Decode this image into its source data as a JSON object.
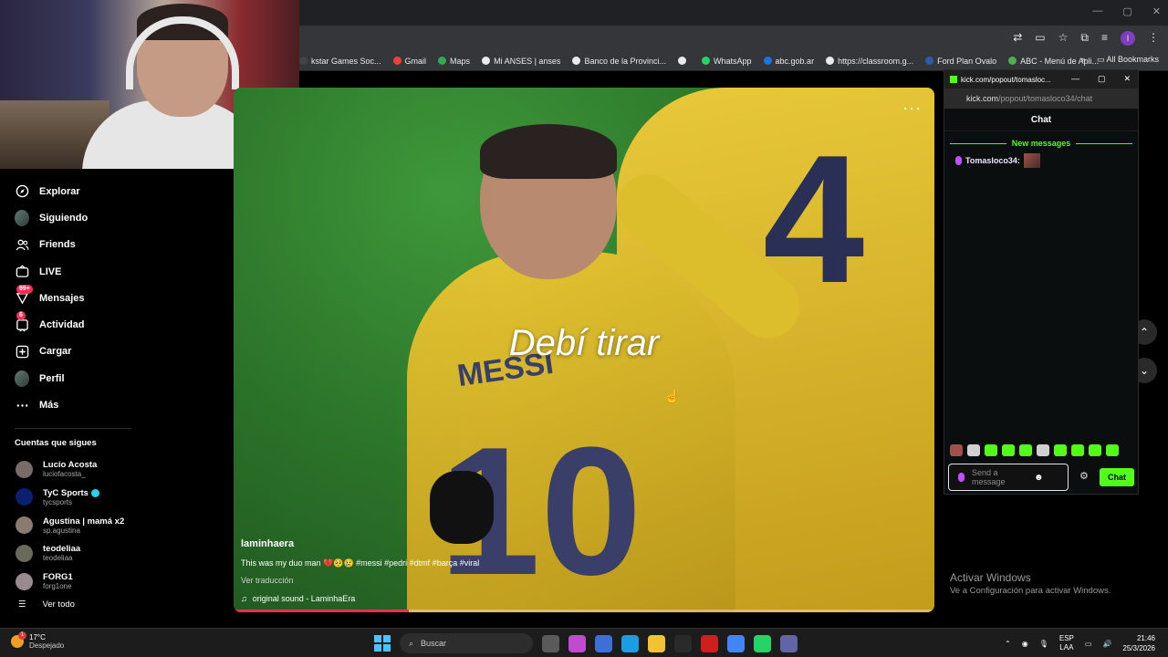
{
  "browser": {
    "bookmarks": [
      {
        "label": "kstar Games Soc...",
        "color": "#444"
      },
      {
        "label": "Gmail",
        "color": "#ea4335"
      },
      {
        "label": "Maps",
        "color": "#34a853"
      },
      {
        "label": "Mi ANSES | anses",
        "color": "#e8eaed"
      },
      {
        "label": "Banco de la Provinci...",
        "color": "#e8eaed"
      },
      {
        "label": "",
        "color": "#e8eaed"
      },
      {
        "label": "WhatsApp",
        "color": "#25d366"
      },
      {
        "label": "abc.gob.ar",
        "color": "#1a73e8"
      },
      {
        "label": "https://classroom.g...",
        "color": "#e8eaed"
      },
      {
        "label": "Ford Plan Ovalo",
        "color": "#2b5ca8"
      },
      {
        "label": "ABC - Menú de Apli...",
        "color": "#4caf50"
      }
    ],
    "all_bookmarks": "All Bookmarks",
    "profile_initial": "I"
  },
  "sidebar": {
    "nav": [
      {
        "label": "Explorar",
        "icon": "compass-icon",
        "badge": ""
      },
      {
        "label": "Siguiendo",
        "icon": "avatar",
        "badge": ""
      },
      {
        "label": "Friends",
        "icon": "friends-icon",
        "badge": ""
      },
      {
        "label": "LIVE",
        "icon": "live-icon",
        "badge": ""
      },
      {
        "label": "Mensajes",
        "icon": "messages-icon",
        "badge": "99+"
      },
      {
        "label": "Actividad",
        "icon": "activity-icon",
        "badge": "6"
      },
      {
        "label": "Cargar",
        "icon": "upload-icon",
        "badge": ""
      },
      {
        "label": "Perfil",
        "icon": "avatar",
        "badge": ""
      },
      {
        "label": "Más",
        "icon": "more-icon",
        "badge": ""
      }
    ],
    "following_title": "Cuentas que sigues",
    "following": [
      {
        "name": "Lucio Acosta",
        "user": "luciofacosta_",
        "verified": false,
        "color": "#7a6a6a"
      },
      {
        "name": "TyC Sports",
        "user": "tycsports",
        "verified": true,
        "color": "#0a1f6e"
      },
      {
        "name": "Agustina | mamá x2",
        "user": "sp.agustina",
        "verified": false,
        "color": "#8a7a70"
      },
      {
        "name": "teodeliaa",
        "user": "teodeliaa",
        "verified": false,
        "color": "#6a6a5a"
      },
      {
        "name": "FORG1",
        "user": "forg1one",
        "verified": false,
        "color": "#9a8a90"
      }
    ],
    "see_all": "Ver todo"
  },
  "video": {
    "caption": "Debí tirar",
    "author": "laminhaera",
    "description": "This was my duo man 💔🥺😢 #messi #pedri #dtmf #barça #viral",
    "translate": "Ver traducción",
    "sound": "original sound - LaminhaEra",
    "progress": 0.25
  },
  "kick": {
    "window_title": "kick.com/popout/tomasloc...",
    "url_main": "kick.com",
    "url_tail": "/popout/tomasloco34/chat",
    "chat_title": "Chat",
    "new_messages": "New messages",
    "message_user": "Tomasloco34:",
    "input_placeholder": "Send a message",
    "send_label": "Chat"
  },
  "activate": {
    "title": "Activar Windows",
    "subtitle": "Ve a Configuración para activar Windows."
  },
  "taskbar": {
    "temp": "17°C",
    "condition": "Despejado",
    "weather_badge": "1",
    "search_placeholder": "Buscar",
    "lang_top": "ESP",
    "lang_bottom": "LAA",
    "time": "21:46",
    "date": "25/3/2026",
    "apps": [
      "#5a5a5a",
      "#c04bd0",
      "#3c6fd8",
      "#1b9de2",
      "#f2c230",
      "#2a2a2a",
      "#d01d1d",
      "#4285f4",
      "#25d366",
      "#6264a7"
    ]
  }
}
